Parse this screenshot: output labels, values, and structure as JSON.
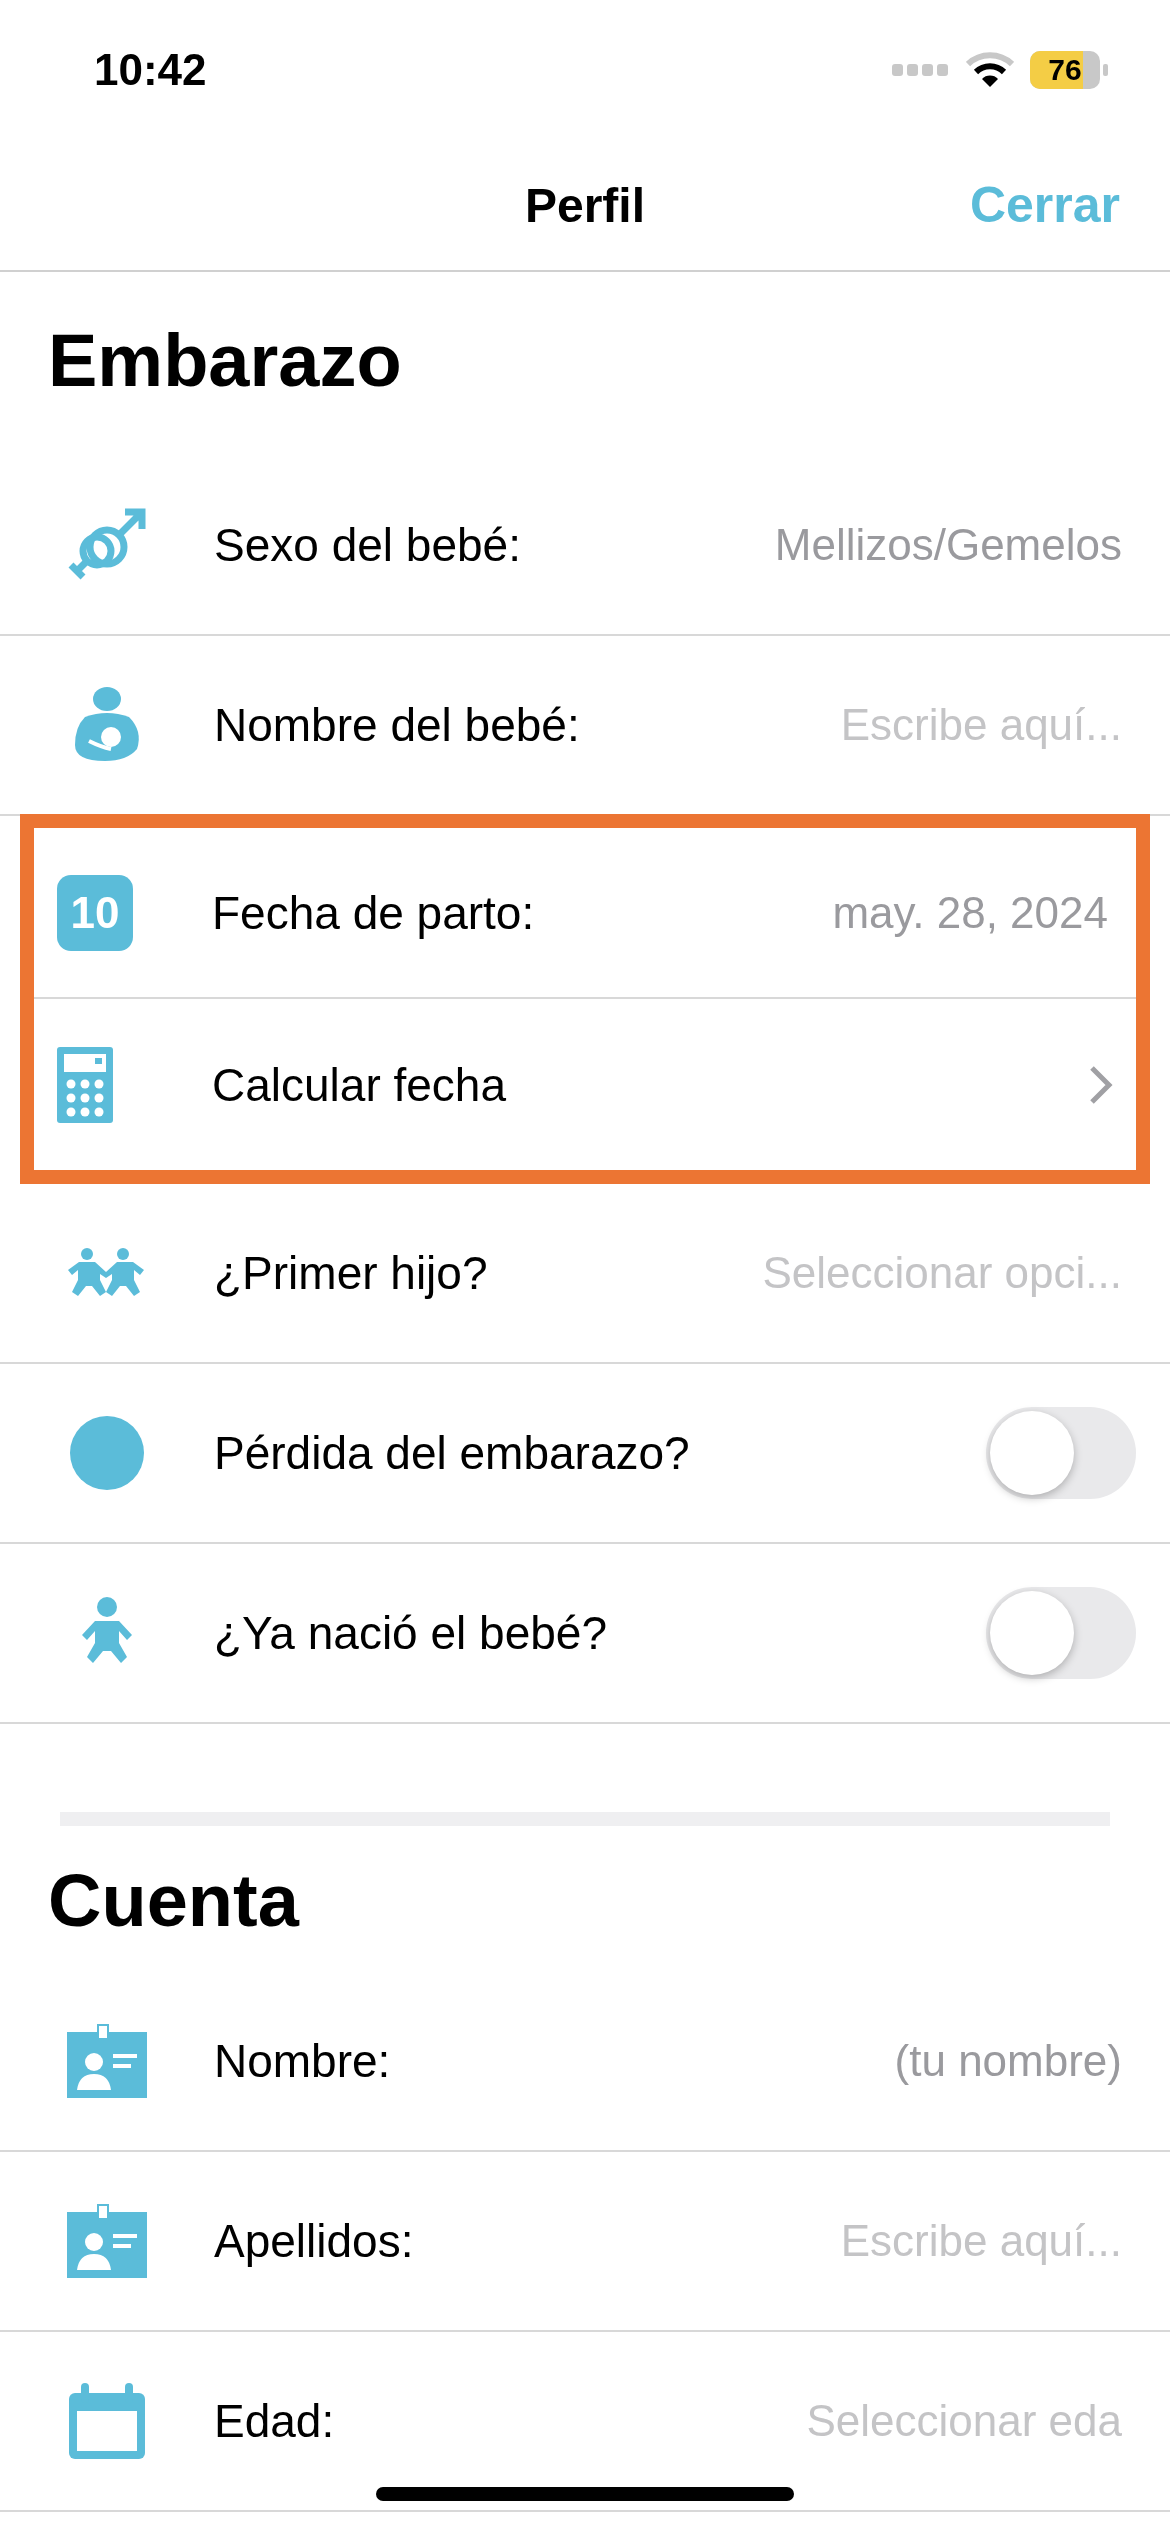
{
  "status_bar": {
    "time": "10:42",
    "battery": "76"
  },
  "nav": {
    "title": "Perfil",
    "action": "Cerrar"
  },
  "sections": [
    {
      "title": "Embarazo",
      "rows": [
        {
          "label": "Sexo del bebé:",
          "kind": "value",
          "value": "Mellizos/Gemelos",
          "highlighted": false
        },
        {
          "label": "Nombre del bebé:",
          "kind": "input",
          "placeholder": "Escribe aquí...",
          "highlighted": false
        },
        {
          "label": "Fecha de parto:",
          "kind": "value",
          "value": "may. 28, 2024",
          "icon_text": "10",
          "highlighted": true
        },
        {
          "label": "Calcular fecha",
          "kind": "link",
          "highlighted": true
        },
        {
          "label": "¿Primer hijo?",
          "kind": "select",
          "placeholder": "Seleccionar opci...",
          "highlighted": false
        },
        {
          "label": "Pérdida del embarazo?",
          "kind": "toggle",
          "on": false,
          "highlighted": false
        },
        {
          "label": "¿Ya nació el bebé?",
          "kind": "toggle",
          "on": false,
          "highlighted": false
        }
      ]
    },
    {
      "title": "Cuenta",
      "rows": [
        {
          "label": "Nombre:",
          "kind": "value",
          "value": "(tu nombre)",
          "highlighted": false
        },
        {
          "label": "Apellidos:",
          "kind": "input",
          "placeholder": "Escribe aquí...",
          "highlighted": false
        },
        {
          "label": "Edad:",
          "kind": "select",
          "placeholder": "Seleccionar eda",
          "highlighted": false
        }
      ]
    }
  ]
}
